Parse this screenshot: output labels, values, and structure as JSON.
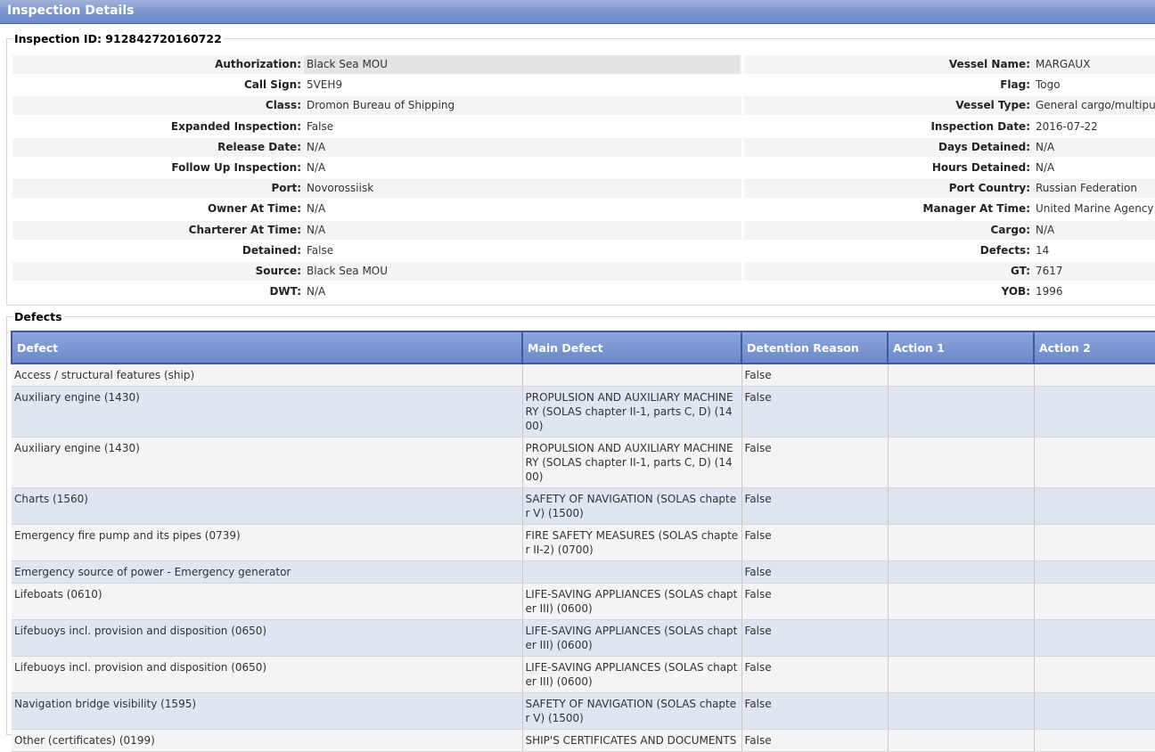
{
  "header": {
    "title": "Inspection Details"
  },
  "inspection": {
    "id_label": "Inspection ID: 912842720160722",
    "left": [
      {
        "label": "Authorization:",
        "value": "Black Sea MOU"
      },
      {
        "label": "Call Sign:",
        "value": "5VEH9"
      },
      {
        "label": "Class:",
        "value": "Dromon Bureau of Shipping"
      },
      {
        "label": "Expanded Inspection:",
        "value": "False"
      },
      {
        "label": "Release Date:",
        "value": "N/A"
      },
      {
        "label": "Follow Up Inspection:",
        "value": "N/A"
      },
      {
        "label": "Port:",
        "value": "Novorossiisk"
      },
      {
        "label": "Owner At Time:",
        "value": "N/A"
      },
      {
        "label": "Charterer At Time:",
        "value": "N/A"
      },
      {
        "label": "Detained:",
        "value": "False"
      },
      {
        "label": "Source:",
        "value": "Black Sea MOU"
      },
      {
        "label": "DWT:",
        "value": "N/A"
      }
    ],
    "right": [
      {
        "label": "Vessel Name:",
        "value": "MARGAUX"
      },
      {
        "label": "Flag:",
        "value": "Togo"
      },
      {
        "label": "Vessel Type:",
        "value": "General cargo/multipur"
      },
      {
        "label": "Inspection Date:",
        "value": "2016-07-22"
      },
      {
        "label": "Days Detained:",
        "value": "N/A"
      },
      {
        "label": "Hours Detained:",
        "value": "N/A"
      },
      {
        "label": "Port Country:",
        "value": "Russian Federation"
      },
      {
        "label": "Manager At Time:",
        "value": "United Marine Agency I"
      },
      {
        "label": "Cargo:",
        "value": "N/A"
      },
      {
        "label": "Defects:",
        "value": "14"
      },
      {
        "label": "GT:",
        "value": "7617"
      },
      {
        "label": "YOB:",
        "value": "1996"
      }
    ]
  },
  "defects": {
    "legend": "Defects",
    "headers": [
      "Defect",
      "Main Defect",
      "Detention Reason",
      "Action 1",
      "Action 2"
    ],
    "rows": [
      [
        "Access / structural features (ship)",
        "",
        "False",
        "",
        ""
      ],
      [
        "Auxiliary engine (1430)",
        "PROPULSION AND AUXILIARY MACHINERY (SOLAS chapter II-1, parts C, D) (1400)",
        "False",
        "",
        ""
      ],
      [
        "Auxiliary engine (1430)",
        "PROPULSION AND AUXILIARY MACHINERY (SOLAS chapter II-1, parts C, D) (1400)",
        "False",
        "",
        ""
      ],
      [
        "Charts (1560)",
        "SAFETY OF NAVIGATION (SOLAS chapter V) (1500)",
        "False",
        "",
        ""
      ],
      [
        "Emergency fire pump and its pipes (0739)",
        "FIRE SAFETY MEASURES (SOLAS chapter II-2) (0700)",
        "False",
        "",
        ""
      ],
      [
        "Emergency source of power - Emergency generator",
        "",
        "False",
        "",
        ""
      ],
      [
        "Lifeboats (0610)",
        "LIFE-SAVING APPLIANCES (SOLAS chapter III) (0600)",
        "False",
        "",
        ""
      ],
      [
        "Lifebuoys incl. provision and disposition (0650)",
        "LIFE-SAVING APPLIANCES (SOLAS chapter III) (0600)",
        "False",
        "",
        ""
      ],
      [
        "Lifebuoys incl. provision and disposition (0650)",
        "LIFE-SAVING APPLIANCES (SOLAS chapter III) (0600)",
        "False",
        "",
        ""
      ],
      [
        "Navigation bridge visibility (1595)",
        "SAFETY OF NAVIGATION (SOLAS chapter V) (1500)",
        "False",
        "",
        ""
      ],
      [
        "Other (certificates) (0199)",
        "SHIP'S CERTIFICATES AND DOCUMENTS",
        "False",
        "",
        ""
      ]
    ]
  }
}
